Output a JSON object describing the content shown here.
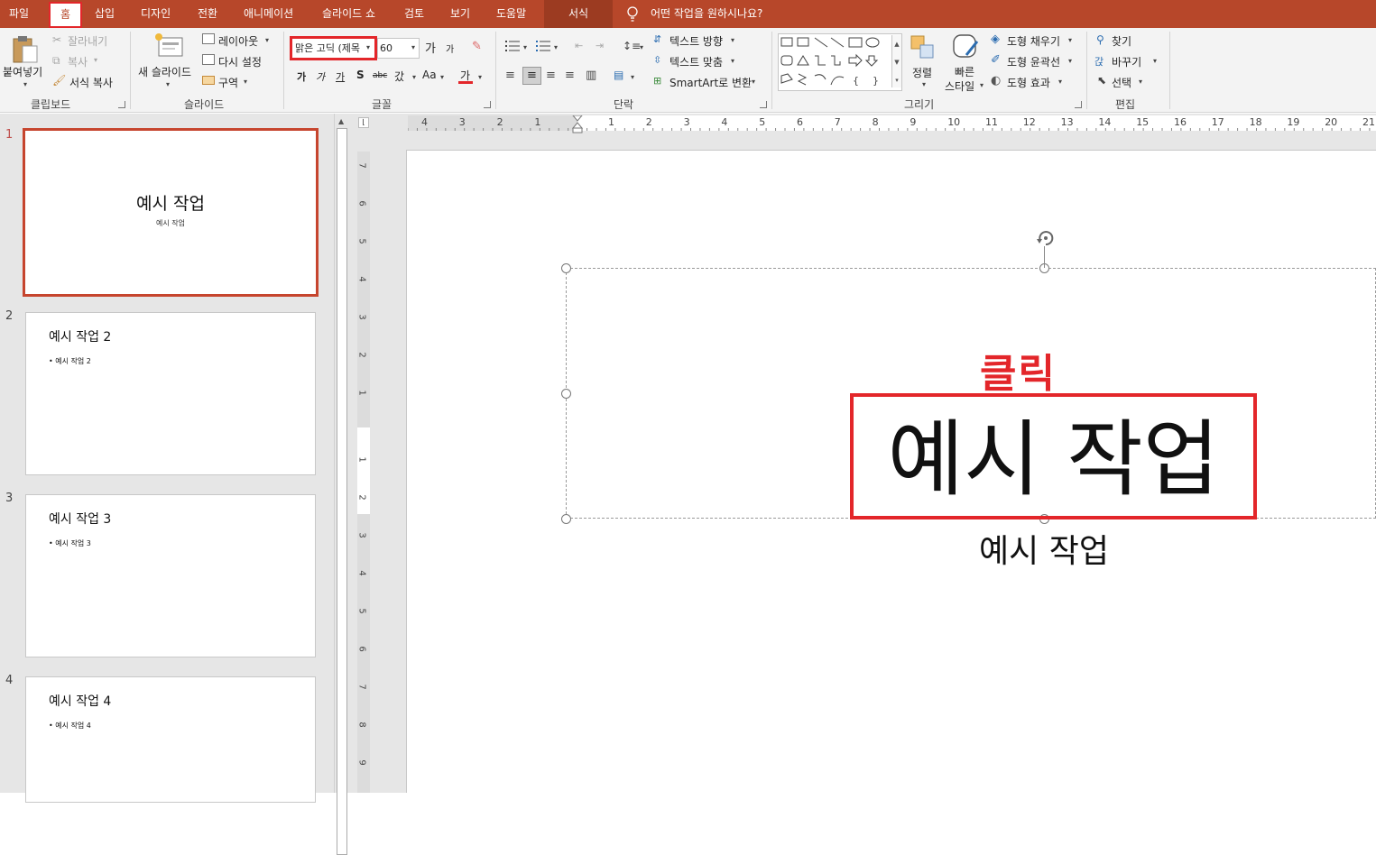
{
  "menu": {
    "tabs": [
      {
        "label": "파일"
      },
      {
        "label": "홈",
        "selected": true
      },
      {
        "label": "삽입"
      },
      {
        "label": "디자인"
      },
      {
        "label": "전환"
      },
      {
        "label": "애니메이션"
      },
      {
        "label": "슬라이드 쇼"
      },
      {
        "label": "검토"
      },
      {
        "label": "보기"
      },
      {
        "label": "도움말"
      }
    ],
    "context_tab": "서식",
    "tell_me": "어떤 작업을 원하시나요?"
  },
  "ribbon": {
    "clipboard": {
      "paste": "붙여넣기",
      "cut": "잘라내기",
      "copy": "복사",
      "format_painter": "서식 복사",
      "group": "클립보드"
    },
    "slides": {
      "new_slide": "새 슬라이드",
      "layout": "레이아웃",
      "reset": "다시 설정",
      "section": "구역",
      "group": "슬라이드"
    },
    "font": {
      "name": "맑은 고딕 (제목",
      "size": "60",
      "grow": "가",
      "shrink": "가",
      "case": "Aa",
      "spacing": "갔",
      "group": "글꼴"
    },
    "paragraph": {
      "text_direction": "텍스트 방향",
      "align_text": "텍스트 맞춤",
      "smartart": "SmartArt로 변환",
      "group": "단락"
    },
    "drawing": {
      "arrange": "정렬",
      "quick_styles_1": "빠른",
      "quick_styles_2": "스타일",
      "shape_fill": "도형 채우기",
      "shape_outline": "도형 윤곽선",
      "shape_effects": "도형 효과",
      "group": "그리기"
    },
    "editing": {
      "find": "찾기",
      "replace": "바꾸기",
      "select": "선택",
      "group": "편집"
    }
  },
  "slides": [
    {
      "num": "1",
      "title": "예시 작업",
      "subtitle": "예시 작업"
    },
    {
      "num": "2",
      "title": "예시 작업 2",
      "bullet": "• 예시 작업 2"
    },
    {
      "num": "3",
      "title": "예시 작업 3",
      "bullet": "• 예시 작업 3"
    },
    {
      "num": "4",
      "title": "예시 작업 4",
      "bullet": "• 예시 작업 4"
    }
  ],
  "ruler": {
    "h_labels": [
      "4",
      "3",
      "2",
      "1",
      "1",
      "2",
      "3",
      "4",
      "5",
      "6",
      "7",
      "8",
      "9",
      "10",
      "11",
      "12",
      "13",
      "14",
      "15",
      "16",
      "17",
      "18",
      "19",
      "20",
      "21"
    ],
    "v_labels": [
      "7",
      "6",
      "5",
      "4",
      "3",
      "2",
      "1",
      "1",
      "2",
      "3",
      "4",
      "5",
      "6",
      "7",
      "8",
      "9"
    ]
  },
  "canvas": {
    "annotation": "클릭",
    "title": "예시 작업",
    "subtitle": "예시 작업"
  },
  "colors": {
    "accent": "#b7472a",
    "highlight": "#e3262a"
  },
  "icons": [
    "paste-icon",
    "cut-icon",
    "copy-icon",
    "format-painter-icon",
    "new-slide-icon",
    "layout-icon",
    "reset-icon",
    "section-icon",
    "bullets-icon",
    "numbering-icon",
    "arrange-icon",
    "quick-styles-icon",
    "find-icon",
    "replace-icon",
    "select-icon",
    "lightbulb-icon",
    "rotate-icon"
  ]
}
